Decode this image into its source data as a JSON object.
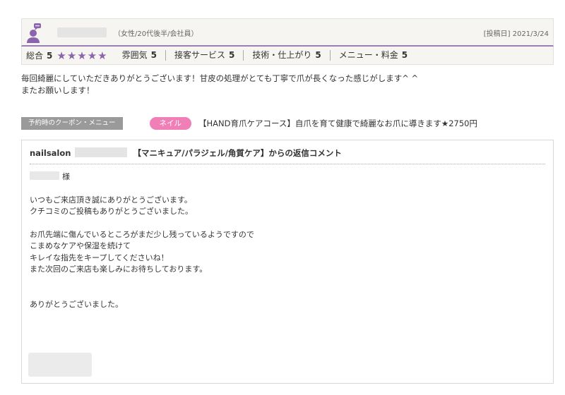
{
  "review": {
    "reviewer_info": "（女性/20代後半/会社員）",
    "post_date": "[投稿日] 2021/3/24",
    "ratings": {
      "total_label": "総合",
      "total_value": "5",
      "stars_text": "★★★★★",
      "items": [
        {
          "label": "雰囲気",
          "value": "5"
        },
        {
          "label": "接客サービス",
          "value": "5"
        },
        {
          "label": "技術・仕上がり",
          "value": "5"
        },
        {
          "label": "メニュー・料金",
          "value": "5"
        }
      ]
    },
    "comment_lines": [
      "毎回綺麗にしていただきありがとうございます！甘皮の処理がとても丁寧で爪が長くなった感じがします^ ^",
      "またお願いします！"
    ],
    "coupon": {
      "label": "予約時のクーポン・メニュー",
      "category": "ネイル",
      "text": "【HAND育爪ケアコース】自爪を育て健康で綺麗なお爪に導きます★2750円"
    }
  },
  "reply": {
    "title_prefix": "nailsalon",
    "title_suffix": "【マニキュア/パラジェル/角質ケア】からの返信コメント",
    "salutation": "様",
    "para1": [
      "いつもご来店頂き誠にありがとうございます。",
      "クチコミのご投稿もありがとうございました。"
    ],
    "para2": [
      "お爪先端に傷んでいるところがまだ少し残っているようですので",
      "こまめなケアや保湿を続けて",
      "キレイな指先をキープしてくださいね！",
      "また次回のご来店も楽しみにお待ちしております。"
    ],
    "closing": "ありがとうございました。"
  },
  "colors": {
    "accent_purple": "#8a64ad",
    "pill_pink": "#ef7fb6",
    "label_gray": "#9a9a9a"
  }
}
